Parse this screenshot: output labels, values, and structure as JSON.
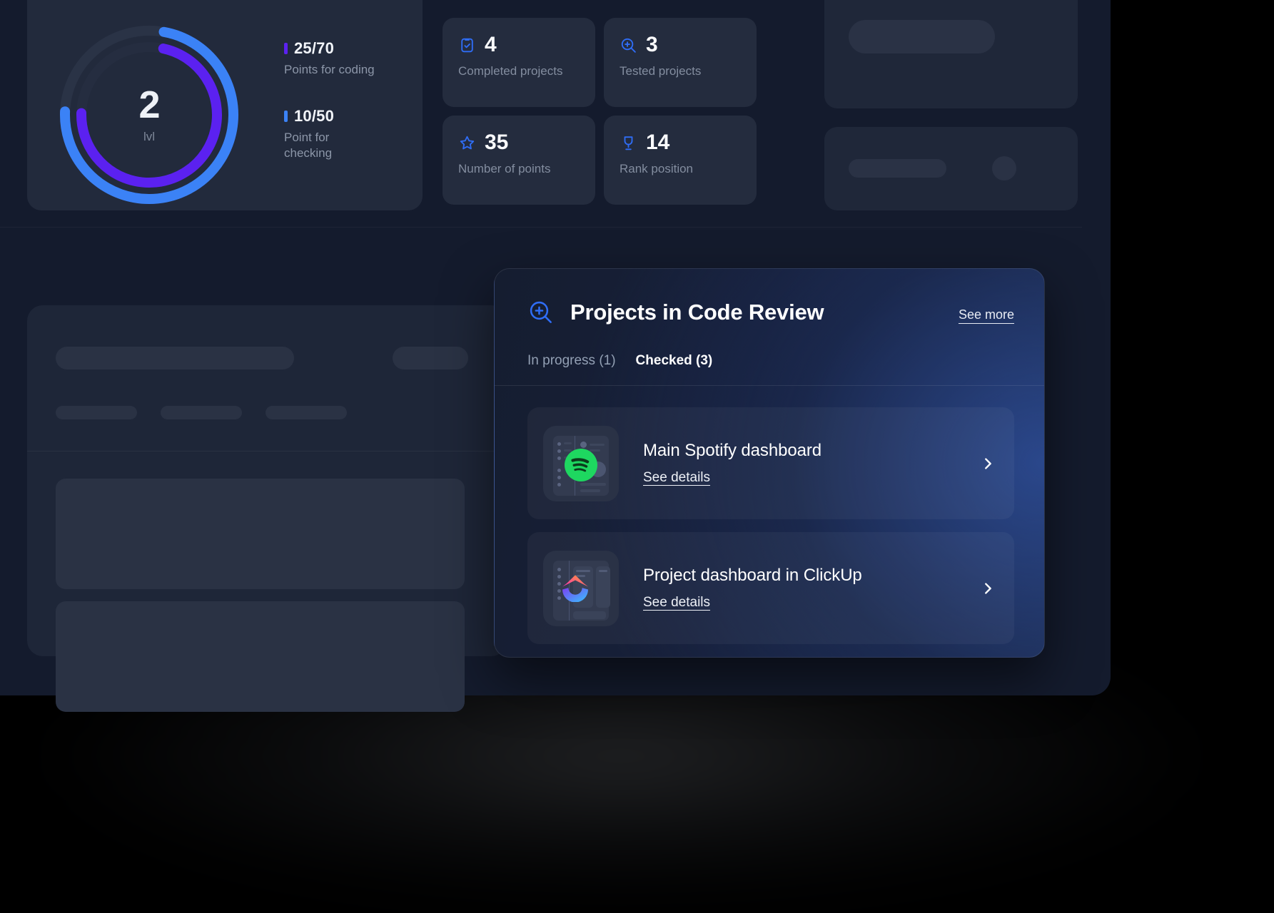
{
  "level_card": {
    "level_value": "2",
    "level_unit": "lvl",
    "ring": {
      "outer_color": "#3b82f6",
      "inner_color": "#5b21f0",
      "track_color": "#2a3346"
    },
    "legend": [
      {
        "marker_color": "#5b21f0",
        "value": "25/70",
        "label": "Points for coding"
      },
      {
        "marker_color": "#3b82f6",
        "value": "10/50",
        "label": "Point for checking"
      }
    ]
  },
  "stats": [
    {
      "icon": "clipboard-check-icon",
      "value": "4",
      "label": "Completed projects"
    },
    {
      "icon": "search-plus-icon",
      "value": "3",
      "label": "Tested projects"
    },
    {
      "icon": "star-icon",
      "value": "35",
      "label": "Number of points"
    },
    {
      "icon": "trophy-icon",
      "value": "14",
      "label": "Rank position"
    }
  ],
  "review_card": {
    "icon": "search-plus-icon",
    "title": "Projects in Code Review",
    "see_more_label": "See more",
    "tabs": [
      {
        "label": "In progress (1)",
        "active": false
      },
      {
        "label": "Checked (3)",
        "active": true
      }
    ],
    "rows": [
      {
        "thumbnail": "spotify-logo-icon",
        "title": "Main Spotify dashboard",
        "link_label": "See details",
        "chevron": "chevron-right-icon"
      },
      {
        "thumbnail": "clickup-logo-icon",
        "title": "Project dashboard in ClickUp",
        "link_label": "See details",
        "chevron": "chevron-right-icon"
      }
    ]
  },
  "theme": {
    "accent_blue": "#2f6df6",
    "accent_purple": "#5b21f0",
    "spotify_green": "#1ed760",
    "window_bg": "#141b2d",
    "card_bg": "#222a3c",
    "page_bg": "#000000"
  }
}
